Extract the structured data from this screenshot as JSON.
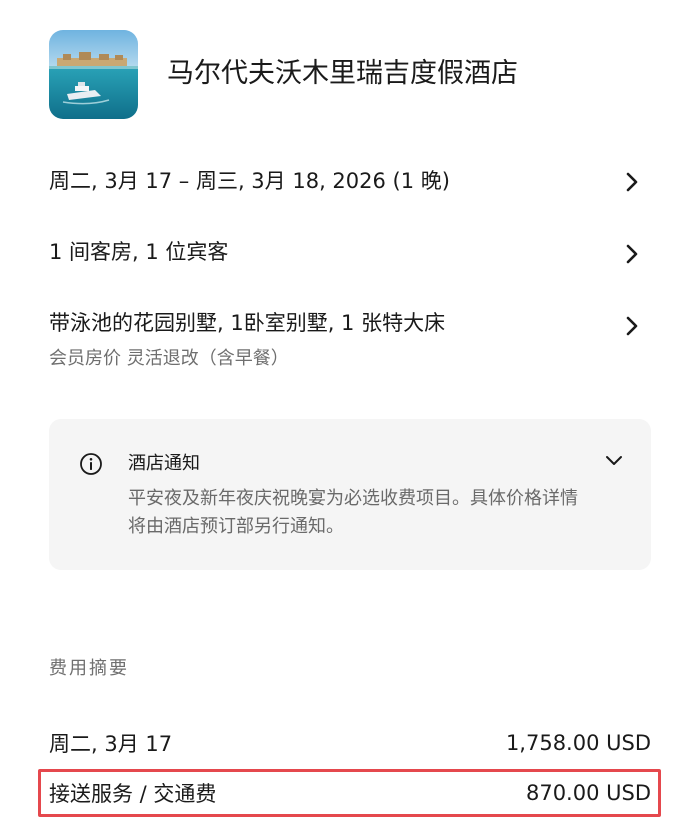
{
  "hotel": {
    "name": "马尔代夫沃木里瑞吉度假酒店"
  },
  "stay": {
    "dates": "周二, 3月 17 – 周三, 3月 18, 2026 (1 晚)",
    "guests": "1 间客房, 1 位宾客",
    "room": "带泳池的花园别墅, 1卧室别墅, 1 张特大床",
    "rate": "会员房价 灵活退改（含早餐）"
  },
  "notice": {
    "title": "酒店通知",
    "body": "平安夜及新年夜庆祝晚宴为必选收费项目。具体价格详情将由酒店预订部另行通知。"
  },
  "summary": {
    "label": "费用摘要",
    "items": [
      {
        "label": "周二, 3月 17",
        "amount": "1,758.00 USD"
      },
      {
        "label": "接送服务 / 交通费",
        "amount": "870.00 USD"
      }
    ]
  },
  "colors": {
    "highlight": "#e5484d",
    "notice_bg": "#f5f5f5",
    "muted_text": "#6f6f6f"
  }
}
